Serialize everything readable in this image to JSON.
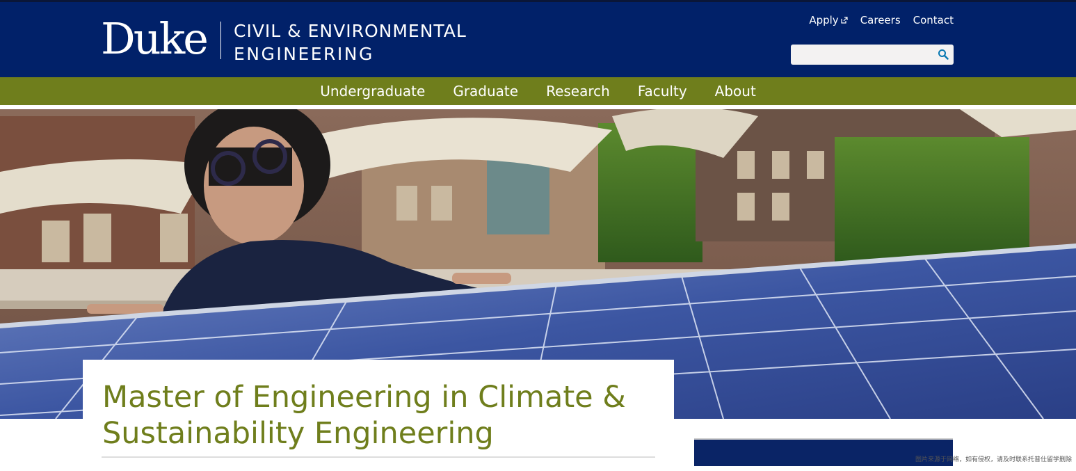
{
  "header": {
    "brand": "Duke",
    "department_line1": "CIVIL & ENVIRONMENTAL",
    "department_line2": "ENGINEERING",
    "links": [
      {
        "label": "Apply"
      },
      {
        "label": "Careers"
      },
      {
        "label": "Contact"
      }
    ],
    "search": {
      "value": "",
      "placeholder": ""
    }
  },
  "nav": {
    "items": [
      {
        "label": "Undergraduate"
      },
      {
        "label": "Graduate"
      },
      {
        "label": "Research"
      },
      {
        "label": "Faculty"
      },
      {
        "label": "About"
      }
    ]
  },
  "hero": {
    "image": "student-with-solar-panel-photo"
  },
  "page": {
    "title": "Master of Engineering in Climate & Sustainability Engineering"
  },
  "watermark": "图片来源于网络，如有侵权，请及时联系托普仕留学删除",
  "colors": {
    "header_blue": "#012169",
    "nav_green": "#6f7e1c",
    "title_green": "#6f7e1c"
  }
}
